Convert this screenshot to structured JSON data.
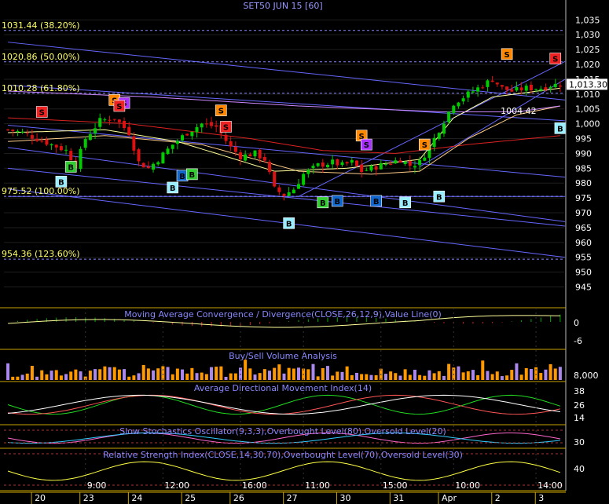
{
  "chart_data": {
    "type": "candlestick",
    "title": "SET50 JUN 15   [60]",
    "colors": {
      "background": "#000000",
      "up": "#00cc00",
      "down": "#dd1111",
      "grid": "#555555",
      "axis_text": "#ffffff",
      "fib_text": "#ffff66",
      "trend": "#6666ff",
      "separator": "#c8a400",
      "panel_title": "#8888ff"
    },
    "price_axis": {
      "ylim": [
        938,
        1038
      ],
      "ticks": [
        945,
        950,
        955,
        960,
        965,
        970,
        975,
        980,
        985,
        990,
        995,
        1000,
        1005,
        1010,
        1015,
        1020,
        1025,
        1030,
        1035
      ],
      "tick_labels": [
        "945",
        "950",
        "955",
        "960",
        "965",
        "970",
        "975",
        "980",
        "985",
        "990",
        "995",
        "1,000",
        "1,005",
        "1,010",
        "1,015",
        "1,020",
        "1,025",
        "1,030",
        "1,035"
      ],
      "last_price": 1013.3,
      "last_price_label": "1,013.30"
    },
    "fib_levels": [
      {
        "value": 1031.44,
        "label": "1031.44 (38.20%)"
      },
      {
        "value": 1020.86,
        "label": "1020.86 (50.00%)"
      },
      {
        "value": 1010.28,
        "label": "1010.28 (61.80%)"
      },
      {
        "value": 975.52,
        "label": "975.52 (100.00%)"
      },
      {
        "value": 954.36,
        "label": "954.36 (123.60%)"
      }
    ],
    "annotation": {
      "label": "1004.42",
      "value": 1004.42,
      "bar": 103
    },
    "bars": 115,
    "anchors": [
      [
        0,
        998
      ],
      [
        3,
        997
      ],
      [
        6,
        995
      ],
      [
        9,
        993
      ],
      [
        12,
        991
      ],
      [
        14,
        986
      ],
      [
        16,
        995
      ],
      [
        19,
        1001
      ],
      [
        22,
        1002
      ],
      [
        25,
        997
      ],
      [
        27,
        987
      ],
      [
        29,
        985
      ],
      [
        31,
        988
      ],
      [
        34,
        993
      ],
      [
        37,
        997
      ],
      [
        40,
        1000
      ],
      [
        43,
        999
      ],
      [
        46,
        992
      ],
      [
        48,
        989
      ],
      [
        51,
        990
      ],
      [
        53,
        988
      ],
      [
        55,
        978
      ],
      [
        57,
        976
      ],
      [
        59,
        978
      ],
      [
        61,
        983
      ],
      [
        64,
        986
      ],
      [
        67,
        987
      ],
      [
        69,
        986
      ],
      [
        71,
        987
      ],
      [
        73,
        984
      ],
      [
        75,
        985
      ],
      [
        77,
        986
      ],
      [
        79,
        987
      ],
      [
        81,
        988
      ],
      [
        83,
        986
      ],
      [
        85,
        987
      ],
      [
        88,
        995
      ],
      [
        90,
        1001
      ],
      [
        92,
        1007
      ],
      [
        94,
        1009
      ],
      [
        96,
        1011
      ],
      [
        98,
        1013
      ],
      [
        100,
        1015
      ],
      [
        102,
        1012
      ],
      [
        104,
        1011
      ],
      [
        107,
        1012
      ],
      [
        110,
        1012
      ],
      [
        112,
        1013
      ],
      [
        114,
        1013.3
      ]
    ],
    "ma_series": [
      {
        "color": "#dd2222",
        "anchors": [
          [
            0,
            1002
          ],
          [
            25,
            1000
          ],
          [
            50,
            995
          ],
          [
            65,
            991
          ],
          [
            80,
            990
          ],
          [
            95,
            993
          ],
          [
            114,
            996
          ]
        ]
      },
      {
        "color": "#ffcc88",
        "anchors": [
          [
            0,
            994
          ],
          [
            20,
            996
          ],
          [
            40,
            993
          ],
          [
            60,
            984
          ],
          [
            75,
            983
          ],
          [
            85,
            984
          ],
          [
            95,
            995
          ],
          [
            105,
            1003
          ],
          [
            114,
            1006
          ]
        ]
      },
      {
        "color": "#ffff99",
        "anchors": [
          [
            0,
            997
          ],
          [
            20,
            998
          ],
          [
            35,
            994
          ],
          [
            55,
            984
          ],
          [
            70,
            985
          ],
          [
            85,
            988
          ],
          [
            92,
            1002
          ],
          [
            100,
            1009
          ],
          [
            114,
            1012
          ]
        ]
      },
      {
        "color": "#cc88ff",
        "anchors": [
          [
            0,
            1011
          ],
          [
            30,
            1009
          ],
          [
            60,
            1006
          ],
          [
            90,
            1004
          ],
          [
            105,
            1004
          ],
          [
            114,
            1006
          ]
        ]
      }
    ],
    "signals": [
      {
        "type": "B",
        "bar": 11,
        "value": 980.5,
        "color": "#99eeff"
      },
      {
        "type": "B",
        "bar": 13,
        "value": 985.5,
        "color": "#33cc33"
      },
      {
        "type": "S",
        "bar": 7,
        "value": 1004,
        "color": "#ee2222"
      },
      {
        "type": "S",
        "bar": 22,
        "value": 1008,
        "color": "#ff8800"
      },
      {
        "type": "S",
        "bar": 24,
        "value": 1007,
        "color": "#aa33ff"
      },
      {
        "type": "S",
        "bar": 23,
        "value": 1006,
        "color": "#ee2222"
      },
      {
        "type": "B",
        "bar": 34,
        "value": 978.5,
        "color": "#99eeff"
      },
      {
        "type": "B",
        "bar": 36,
        "value": 982.5,
        "color": "#1166cc"
      },
      {
        "type": "B",
        "bar": 38,
        "value": 983,
        "color": "#33cc33"
      },
      {
        "type": "S",
        "bar": 44,
        "value": 1004.5,
        "color": "#ff8800"
      },
      {
        "type": "S",
        "bar": 45,
        "value": 999,
        "color": "#ee2222"
      },
      {
        "type": "B",
        "bar": 58,
        "value": 966.5,
        "color": "#99eeff"
      },
      {
        "type": "B",
        "bar": 65,
        "value": 973.5,
        "color": "#33cc33"
      },
      {
        "type": "B",
        "bar": 68,
        "value": 974,
        "color": "#1166cc"
      },
      {
        "type": "S",
        "bar": 73,
        "value": 996,
        "color": "#ff8800"
      },
      {
        "type": "S",
        "bar": 74,
        "value": 993,
        "color": "#aa33ff"
      },
      {
        "type": "B",
        "bar": 76,
        "value": 974,
        "color": "#1166cc"
      },
      {
        "type": "B",
        "bar": 82,
        "value": 973.5,
        "color": "#99eeff"
      },
      {
        "type": "S",
        "bar": 86,
        "value": 993,
        "color": "#ff8800"
      },
      {
        "type": "B",
        "bar": 89,
        "value": 975.5,
        "color": "#99eeff"
      },
      {
        "type": "S",
        "bar": 103,
        "value": 1023.5,
        "color": "#ff8800"
      },
      {
        "type": "S",
        "bar": 113,
        "value": 1022,
        "color": "#ee2222"
      },
      {
        "type": "B",
        "bar": 114,
        "value": 998.5,
        "color": "#99eeff"
      }
    ],
    "trendlines": [
      [
        [
          0,
          1027.5
        ],
        [
          115,
          1008
        ]
      ],
      [
        [
          0,
          1013
        ],
        [
          115,
          1001
        ]
      ],
      [
        [
          0,
          999.5
        ],
        [
          115,
          982
        ]
      ],
      [
        [
          0,
          992
        ],
        [
          115,
          967
        ]
      ],
      [
        [
          0,
          985
        ],
        [
          115,
          965.5
        ]
      ],
      [
        [
          0,
          978
        ],
        [
          115,
          955
        ]
      ],
      [
        [
          0,
          975.5
        ],
        [
          115,
          975.5
        ]
      ],
      [
        [
          60,
          975.5
        ],
        [
          115,
          1021
        ]
      ],
      [
        [
          85,
          985.5
        ],
        [
          115,
          1015
        ]
      ]
    ],
    "panels": [
      {
        "id": "macd",
        "title": "Moving Average Convergence / Divergence(CLOSE,26,12,9),Value Line(0)",
        "ticks": [
          "0",
          "-6"
        ]
      },
      {
        "id": "volume",
        "title": "Buy/Sell Volume Analysis",
        "ticks": [
          "8,000"
        ]
      },
      {
        "id": "adx",
        "title": "Average Directional Movement Index(14)",
        "ticks": [
          "38",
          "26",
          "14"
        ]
      },
      {
        "id": "stoch",
        "title": "Slow Stochastics Oscillator(9,3,3),Overbought Level(80),Oversold Level(20)",
        "ticks": [
          "30"
        ]
      },
      {
        "id": "rsi",
        "title": "Relative Strength Index(CLOSE,14,30,70),Overbought Level(70),Oversold Level(30)",
        "ticks": [
          "40"
        ]
      }
    ],
    "time_axis": {
      "upper": [
        {
          "label": "9:00",
          "bar": 16
        },
        {
          "label": "12:00",
          "bar": 32
        },
        {
          "label": "16:00",
          "bar": 48
        },
        {
          "label": "11:00",
          "bar": 61
        },
        {
          "label": "15:00",
          "bar": 77
        },
        {
          "label": "10:00",
          "bar": 92
        },
        {
          "label": "14:00",
          "bar": 109
        }
      ],
      "lower": [
        {
          "label": "20",
          "bar": 6
        },
        {
          "label": "23",
          "bar": 16
        },
        {
          "label": "24",
          "bar": 26
        },
        {
          "label": "25",
          "bar": 37
        },
        {
          "label": "26",
          "bar": 47
        },
        {
          "label": "27",
          "bar": 58
        },
        {
          "label": "30",
          "bar": 69
        },
        {
          "label": "31",
          "bar": 80
        },
        {
          "label": "Apr",
          "bar": 90
        },
        {
          "label": "2",
          "bar": 101
        },
        {
          "label": "3",
          "bar": 110
        }
      ]
    }
  }
}
